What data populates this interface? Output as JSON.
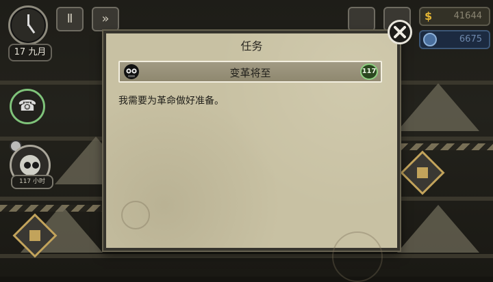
{
  "hud": {
    "date": "17 九月",
    "pause_label": "Ⅱ",
    "fast_forward_label": "»",
    "money": "41644",
    "money_symbol": "$",
    "gems": "6675"
  },
  "left_panel": {
    "character_timer": "117 小时"
  },
  "dialog": {
    "title": "任务",
    "task_name": "变革将至",
    "task_badge": "117",
    "task_description": "我需要为革命做好准备。"
  },
  "colors": {
    "dialog_bg": "#c8c1a3",
    "header_bg": "#9b947c",
    "money": "#e3b534",
    "badge_ring": "#8ed081"
  }
}
